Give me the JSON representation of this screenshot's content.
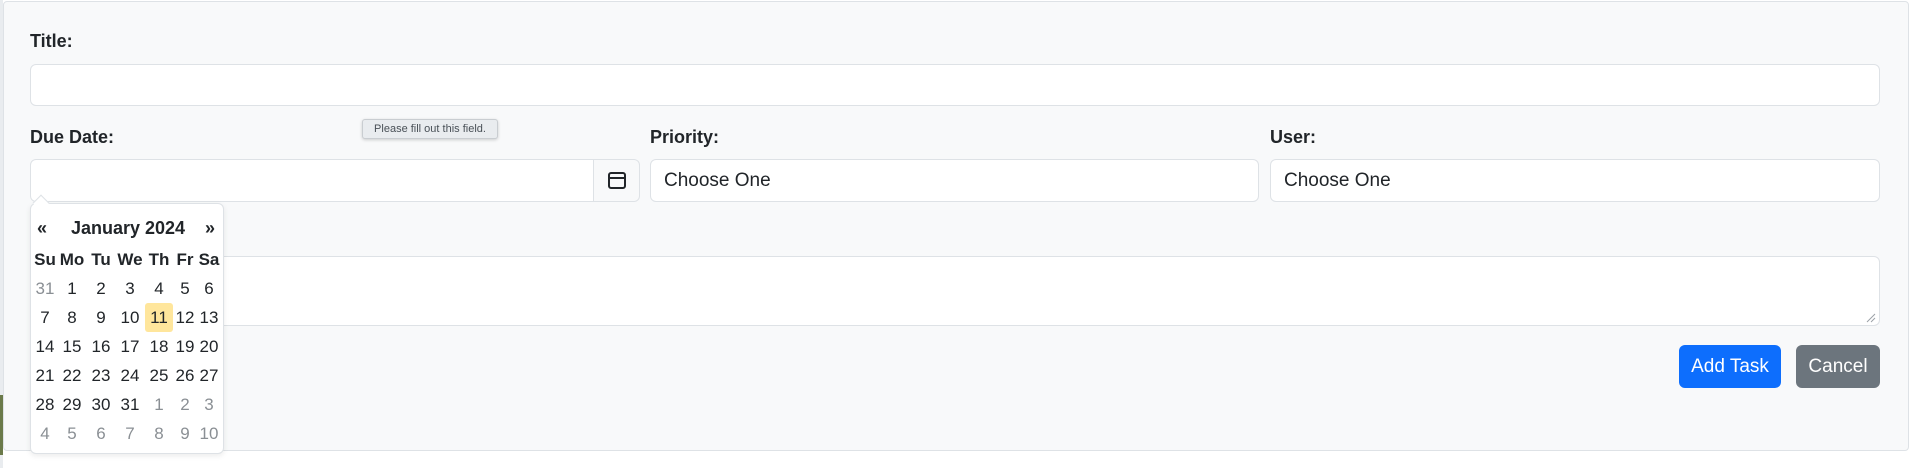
{
  "form": {
    "title_label": "Title:",
    "title_value": "",
    "due_date_label": "Due Date:",
    "due_date_value": "",
    "priority_label": "Priority:",
    "priority_value": "Choose One",
    "user_label": "User:",
    "user_value": "Choose One",
    "description_value": "",
    "validation_tooltip": "Please fill out this field.",
    "add_button": "Add Task",
    "cancel_button": "Cancel"
  },
  "icons": {
    "calendar_button": "calendar-icon",
    "resize_handle": "resize-grip-icon"
  },
  "datepicker": {
    "prev": "«",
    "next": "»",
    "title": "January 2024",
    "weekdays": [
      "Su",
      "Mo",
      "Tu",
      "We",
      "Th",
      "Fr",
      "Sa"
    ],
    "weeks": [
      [
        "31",
        "1",
        "2",
        "3",
        "4",
        "5",
        "6"
      ],
      [
        "7",
        "8",
        "9",
        "10",
        "11",
        "12",
        "13"
      ],
      [
        "14",
        "15",
        "16",
        "17",
        "18",
        "19",
        "20"
      ],
      [
        "21",
        "22",
        "23",
        "24",
        "25",
        "26",
        "27"
      ],
      [
        "28",
        "29",
        "30",
        "31",
        "1",
        "2",
        "3"
      ],
      [
        "4",
        "5",
        "6",
        "7",
        "8",
        "9",
        "10"
      ]
    ],
    "highlighted_day": "11"
  },
  "colors": {
    "primary": "#0d6efd",
    "secondary": "#6c757d",
    "today_highlight": "#ffe69c",
    "muted_day": "#8a8f94"
  }
}
